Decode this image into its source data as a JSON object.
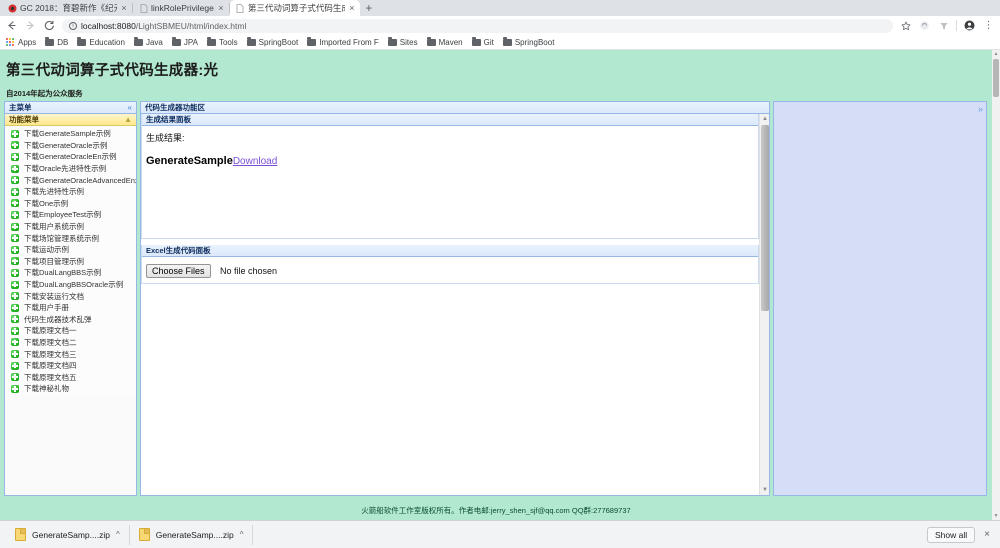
{
  "browser": {
    "tabs": [
      {
        "title": "GC 2018：育碧新作《纪元",
        "favicon": "ubisoft-favicon",
        "active": false,
        "close_label": "×"
      },
      {
        "title": "linkRolePrivilege",
        "favicon": "page-favicon",
        "active": false,
        "close_label": "×"
      },
      {
        "title": "第三代动词算子式代码生成",
        "favicon": "page-favicon",
        "active": true,
        "close_label": "×"
      }
    ],
    "new_tab_label": "+",
    "toolbar": {
      "back_label": "←",
      "forward_label": "→",
      "reload_label": "C",
      "url_host": "localhost:8080",
      "url_path": "/LightSBMEU/html/index.html",
      "url_full": "localhost:8080/LightSBMEU/html/index.html",
      "info_label": "i",
      "star_label": "☆",
      "extension_label": "⬤",
      "filter_label": "▼",
      "profile_label": "●",
      "menu_label": "⋮"
    },
    "bookmarks": [
      {
        "label": "Apps",
        "icon": "apps-grid-icon"
      },
      {
        "label": "DB",
        "icon": "folder-icon"
      },
      {
        "label": "Education",
        "icon": "folder-icon"
      },
      {
        "label": "Java",
        "icon": "folder-icon"
      },
      {
        "label": "JPA",
        "icon": "folder-icon"
      },
      {
        "label": "Tools",
        "icon": "folder-icon"
      },
      {
        "label": "SpringBoot",
        "icon": "folder-icon"
      },
      {
        "label": "Imported From F",
        "icon": "folder-icon"
      },
      {
        "label": "Sites",
        "icon": "folder-icon"
      },
      {
        "label": "Maven",
        "icon": "folder-icon"
      },
      {
        "label": "Git",
        "icon": "folder-icon"
      },
      {
        "label": "SpringBoot",
        "icon": "folder-icon"
      }
    ]
  },
  "page": {
    "title": "第三代动词算子式代码生成器:光",
    "subtitle": "自2014年起为公众服务",
    "west": {
      "header": "主菜单",
      "collapse_label": "«",
      "accordion_header": "功能菜单",
      "accordion_collapse_label": "▲",
      "items": [
        {
          "label": "下载GenerateSample示例"
        },
        {
          "label": "下载GenerateOracle示例"
        },
        {
          "label": "下载GenerateOracleEn示例"
        },
        {
          "label": "下载Oracle先进特性示例"
        },
        {
          "label": "下载GenerateOracleAdvancedEn示例"
        },
        {
          "label": "下载先进特性示例"
        },
        {
          "label": "下载One示例"
        },
        {
          "label": "下载EmployeeTest示例"
        },
        {
          "label": "下载用户系统示例"
        },
        {
          "label": "下载场馆管理系统示例"
        },
        {
          "label": "下载运动示例"
        },
        {
          "label": "下载项目管理示例"
        },
        {
          "label": "下载DualLangBBS示例"
        },
        {
          "label": "下载DualLangBBSOracle示例"
        },
        {
          "label": "下载安装运行文档"
        },
        {
          "label": "下载用户手册"
        },
        {
          "label": "代码生成器技术乱弹"
        },
        {
          "label": "下载原理文档一"
        },
        {
          "label": "下载原理文档二"
        },
        {
          "label": "下载原理文档三"
        },
        {
          "label": "下载原理文档四"
        },
        {
          "label": "下载原理文档五"
        },
        {
          "label": "下载神秘礼物"
        }
      ]
    },
    "center": {
      "header": "代码生成器功能区",
      "result_panel_header": "生成结果面板",
      "result_label": "生成结果:",
      "result_name": "GenerateSample",
      "result_download_label": "Download",
      "excel_panel_header": "Excel生成代码面板",
      "file_button_label": "Choose Files",
      "file_status_label": "No file chosen"
    },
    "east": {
      "collapse_label": "»"
    },
    "footer": "火箭船软件工作室版权所有。作者电邮:jerry_shen_sjf@qq.com QQ群:277689737",
    "scrollbar": {
      "up_label": "▲",
      "down_label": "▼"
    }
  },
  "download_shelf": {
    "items": [
      {
        "name": "GenerateSamp....zip",
        "caret_label": "^"
      },
      {
        "name": "GenerateSamp....zip",
        "caret_label": "^"
      }
    ],
    "show_all_label": "Show all",
    "close_label": "×"
  }
}
